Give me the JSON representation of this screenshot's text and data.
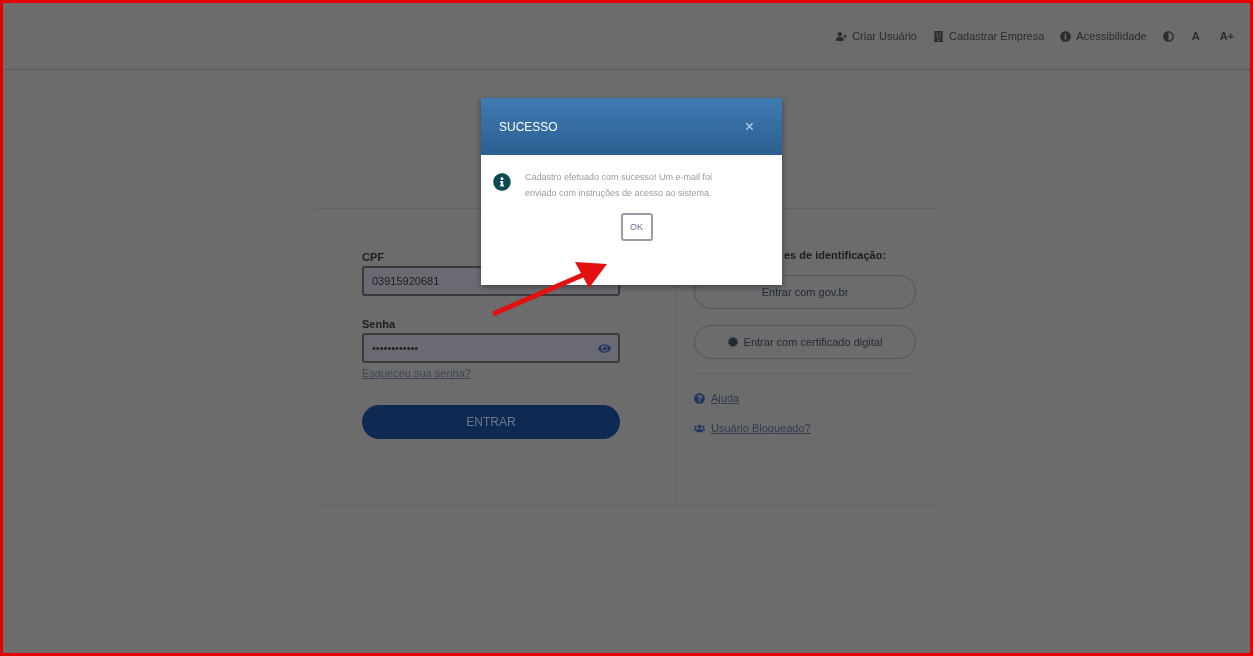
{
  "header": {
    "links": [
      {
        "kind": "user",
        "label": "Criar Usuário"
      },
      {
        "kind": "building",
        "label": "Cadastrar Empresa"
      },
      {
        "kind": "info",
        "label": "Acessibilidade"
      }
    ],
    "contrast": true,
    "font_buttons": [
      "A",
      "A+"
    ]
  },
  "login": {
    "cpf": {
      "label": "CPF",
      "value": "03915920681"
    },
    "password": {
      "label": "Senha",
      "value": "••••••••••••"
    },
    "forgot": "Esqueceu sua senha?",
    "submit": "ENTRAR"
  },
  "identification": {
    "heading": "es de identificação:",
    "buttons": [
      {
        "kind": "gov",
        "label": "Entrar com gov.br"
      },
      {
        "kind": "cert",
        "label": "Entrar com certificado digital"
      }
    ],
    "links": [
      {
        "kind": "help",
        "label": "Ajuda"
      },
      {
        "kind": "blocked",
        "label": "Usuário Bloqueado?"
      }
    ]
  },
  "dialog": {
    "title": "SUCESSO",
    "message": "Cadastro efetuado com sucesso! Um e-mail foi enviado com instruções de acesso ao sistema.",
    "button": "OK",
    "close": "×"
  }
}
